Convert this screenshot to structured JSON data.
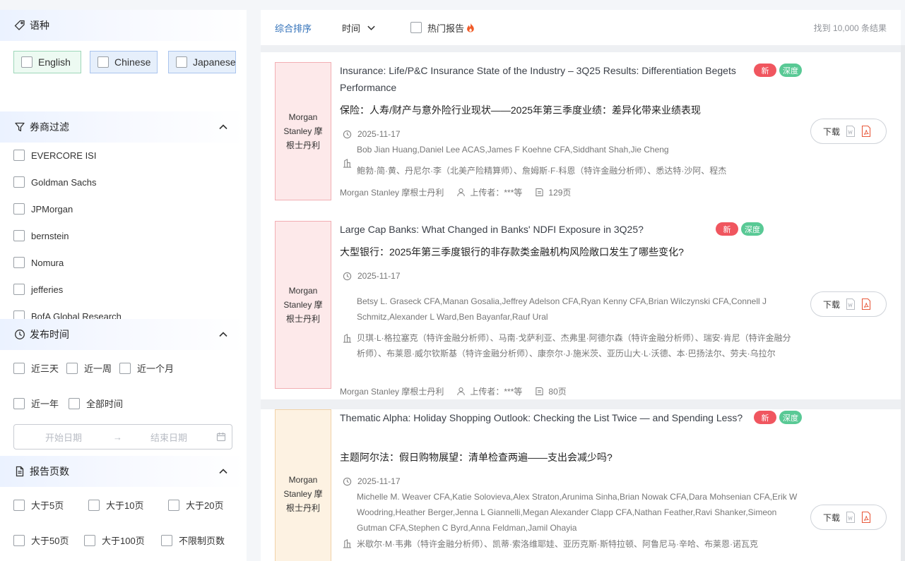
{
  "sidebar": {
    "language": {
      "title": "语种",
      "icon": "tag-icon",
      "options": [
        "English",
        "Chinese",
        "Japanese"
      ]
    },
    "brokers": {
      "title": "券商过滤",
      "icon": "funnel-icon",
      "items": [
        "EVERCORE ISI",
        "Goldman Sachs",
        "JPMorgan",
        "bernstein",
        "Nomura",
        "jefferies",
        "BofA Global Research"
      ]
    },
    "publish_time": {
      "title": "发布时间",
      "icon": "clock-icon",
      "options": [
        "近三天",
        "近一周",
        "近一个月",
        "近一年",
        "全部时间"
      ],
      "start_placeholder": "开始日期",
      "end_placeholder": "结束日期",
      "arrow": "→"
    },
    "pages": {
      "title": "报告页数",
      "icon": "document-icon",
      "options": [
        "大于5页",
        "大于10页",
        "大于20页",
        "大于50页",
        "大于100页",
        "不限制页数"
      ]
    }
  },
  "toolbar": {
    "sort_label": "综合排序",
    "time_label": "时间",
    "hot_label": "热门报告",
    "result_count": "找到 10,000 条结果"
  },
  "reports": [
    {
      "cover": "Morgan Stanley 摩根士丹利",
      "title": "Insurance: Life/P&C Insurance State of the Industry – 3Q25 Results: Differentiation Begets Performance",
      "title_zh": "保险：人寿/财产与意外险行业现状——2025年第三季度业绩：差异化带来业绩表现",
      "date": "2025-11-17",
      "authors": "Bob Jian Huang,Daniel Lee ACAS,James F Koehne CFA,Siddhant Shah,Jie Cheng",
      "authors_zh": "鲍勃·简·黄、丹尼尔·李（北美产险精算师）、詹姆斯·F·科恩（特许金融分析师）、悉达特·沙阿、程杰",
      "broker": "Morgan Stanley 摩根士丹利",
      "uploader": "上传者：***等",
      "pages": "129页",
      "badge_new": "新",
      "badge_deep": "深度",
      "download": "下载"
    },
    {
      "cover": "Morgan Stanley 摩根士丹利",
      "title": "Large Cap Banks: What Changed in Banks' NDFI Exposure in 3Q25?",
      "title_zh": "大型银行：2025年第三季度银行的非存款类金融机构风险敞口发生了哪些变化?",
      "date": "2025-11-17",
      "authors": "Betsy L. Graseck CFA,Manan Gosalia,Jeffrey Adelson CFA,Ryan Kenny CFA,Brian Wilczynski CFA,Connell J Schmitz,Alexander L Ward,Ben Bayanfar,Rauf Ural",
      "authors_zh": "贝琪·L·格拉塞克（特许金融分析师）、马南·戈萨利亚、杰弗里·阿德尔森（特许金融分析师）、瑞安·肯尼（特许金融分析师）、布莱恩·威尔钦斯基（特许金融分析师）、康奈尔·J·施米茨、亚历山大·L·沃德、本·巴扬法尔、劳夫·乌拉尔",
      "broker": "Morgan Stanley 摩根士丹利",
      "uploader": "上传者：***等",
      "pages": "80页",
      "badge_new": "新",
      "badge_deep": "深度",
      "download": "下载"
    },
    {
      "cover": "Morgan Stanley 摩根士丹利",
      "title": "Thematic Alpha: Holiday Shopping Outlook: Checking the List Twice — and Spending Less?",
      "title_zh": "主题阿尔法：假日购物展望：清单检查两遍——支出会减少吗?",
      "date": "2025-11-17",
      "authors": "Michelle M. Weaver CFA,Katie Solovieva,Alex Straton,Arunima Sinha,Brian Nowak CFA,Dara Mohsenian CFA,Erik W Woodring,Heather Berger,Jenna L Giannelli,Megan Alexander Clapp CFA,Nathan Feather,Ravi Shanker,Simeon Gutman CFA,Stephen C Byrd,Anna Feldman,Jamil Ohayia",
      "authors_zh": "米歇尔·M·韦弗（特许金融分析师）、凯蒂·索洛维耶娃、亚历克斯·斯特拉顿、阿鲁尼马·辛哈、布莱恩·诺瓦克",
      "badge_new": "新",
      "badge_deep": "深度",
      "download": "下载"
    }
  ]
}
